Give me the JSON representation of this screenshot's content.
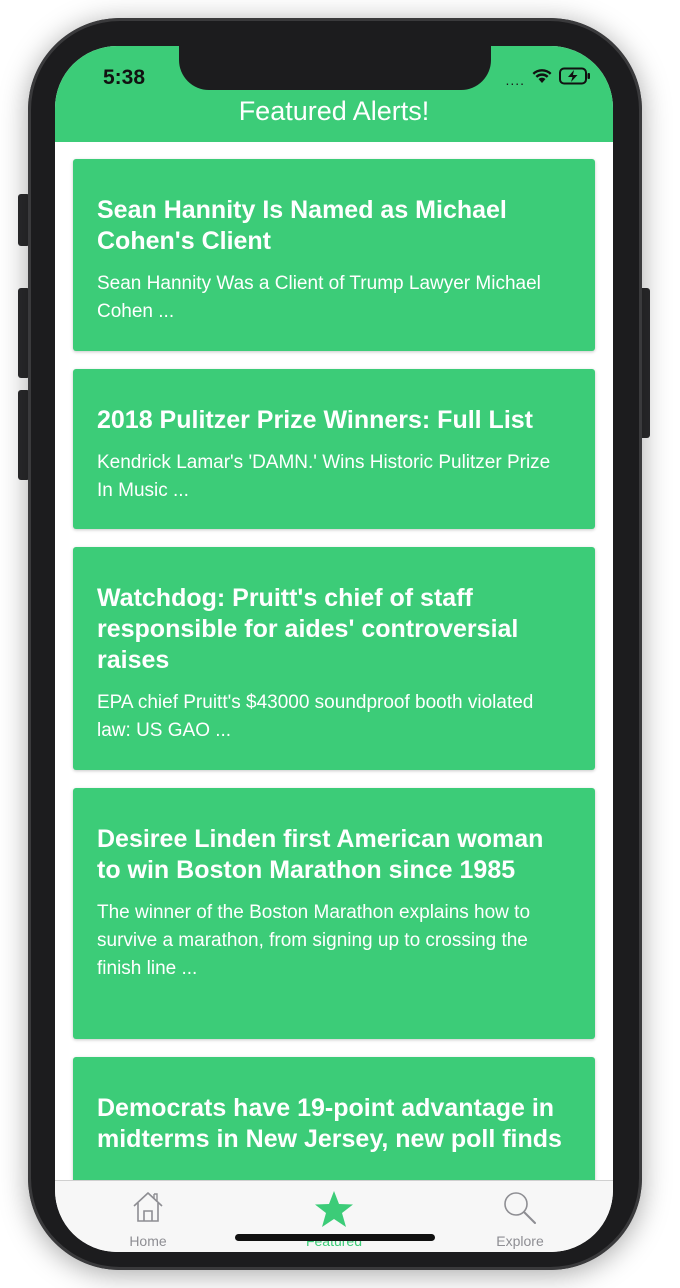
{
  "status_bar": {
    "time": "5:38",
    "signal_dots": "....",
    "icons": [
      "wifi-icon",
      "battery-charging-icon"
    ]
  },
  "header": {
    "title": "Featured Alerts!"
  },
  "colors": {
    "accent": "#3ccc78",
    "tab_inactive": "#8e8e93"
  },
  "alerts": [
    {
      "title": "Sean Hannity Is Named as Michael Cohen's Client",
      "description": "Sean Hannity Was a Client of Trump Lawyer Michael Cohen ..."
    },
    {
      "title": "2018 Pulitzer Prize Winners: Full List",
      "description": "Kendrick Lamar's 'DAMN.' Wins Historic Pulitzer Prize In Music ..."
    },
    {
      "title": "Watchdog: Pruitt's chief of staff responsible for aides' controversial raises",
      "description": "EPA chief Pruitt's $43000 soundproof booth violated law: US GAO ..."
    },
    {
      "title": "Desiree Linden first American woman to win Boston Marathon since 1985",
      "description": "The winner of the Boston Marathon explains how to survive a marathon, from signing up to crossing the finish line ..."
    },
    {
      "title": "Democrats have 19-point advantage in midterms in New Jersey, new poll finds",
      "description": ""
    }
  ],
  "tabbar": {
    "tabs": [
      {
        "label": "Home",
        "icon": "home-icon",
        "active": false
      },
      {
        "label": "Featured",
        "icon": "star-icon",
        "active": true
      },
      {
        "label": "Explore",
        "icon": "search-icon",
        "active": false
      }
    ]
  }
}
